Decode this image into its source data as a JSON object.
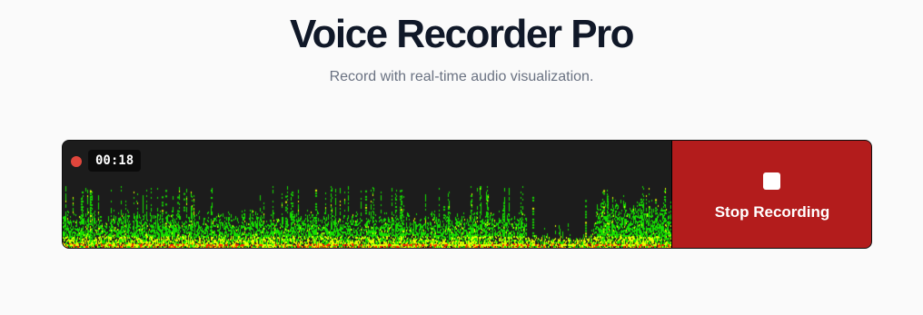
{
  "header": {
    "title": "Voice Recorder Pro",
    "subtitle": "Record with real-time audio visualization."
  },
  "recorder": {
    "timer": "00:18",
    "recording_indicator_color": "#e0463c",
    "stop_button_label": "Stop Recording",
    "stop_icon": "stop-icon",
    "stop_button_color": "#b31c1c",
    "visualization": "spectrogram",
    "spectrogram_colors": [
      "#16e000",
      "#e8ff00",
      "#ff2a00"
    ]
  }
}
